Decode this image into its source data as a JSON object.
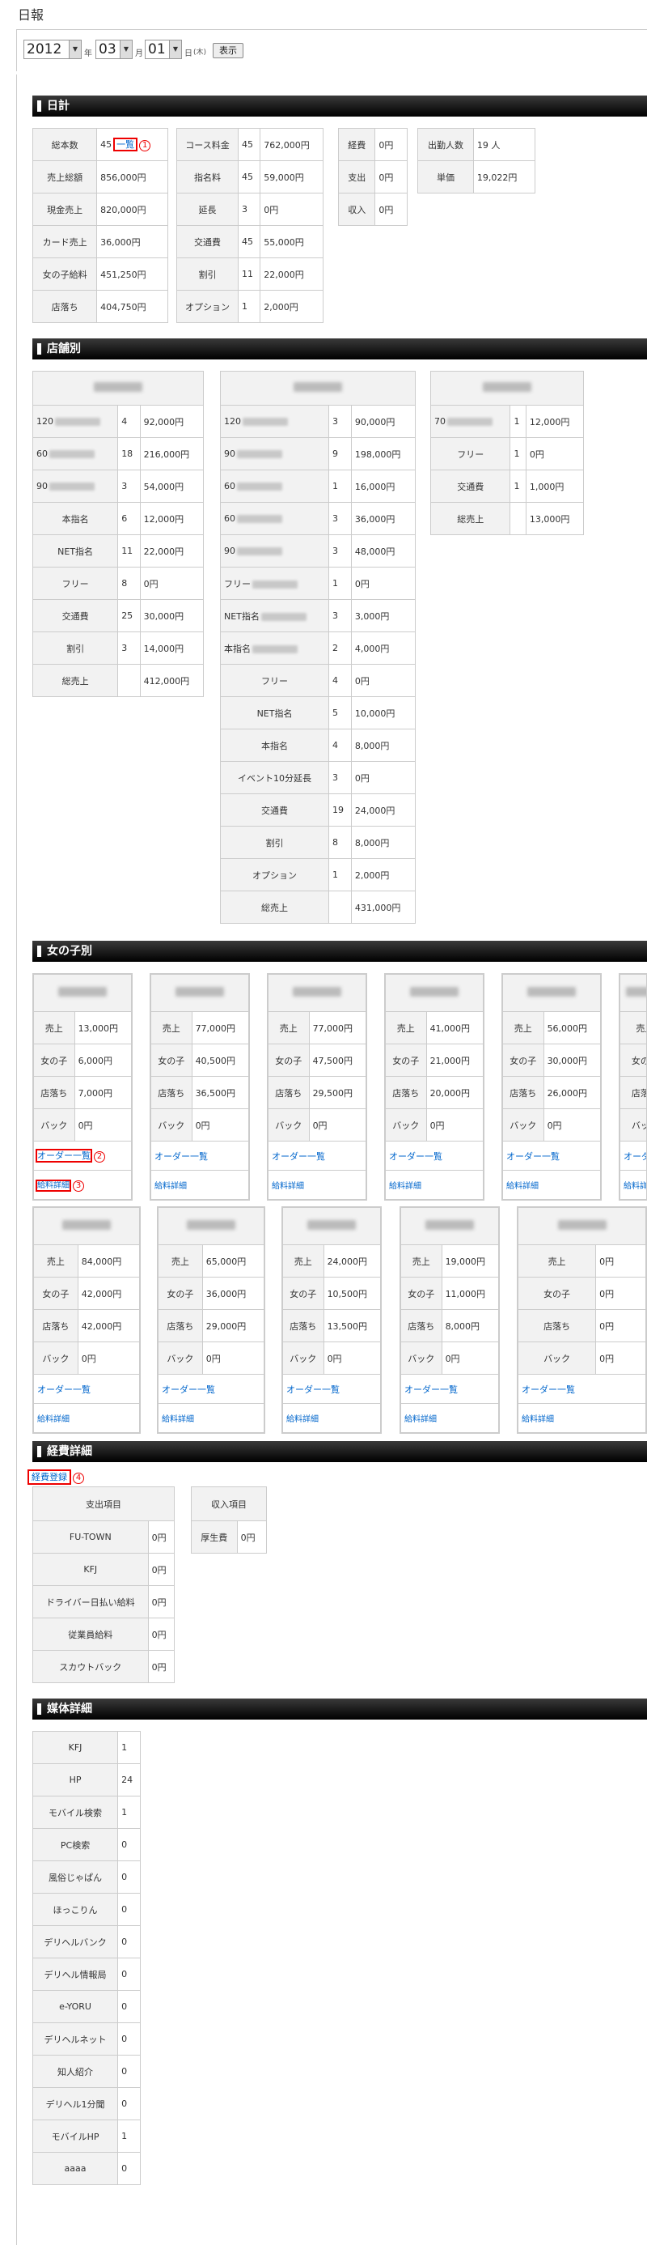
{
  "page_title": "日報",
  "date": {
    "year": "2012",
    "year_unit": "年",
    "month": "03",
    "month_unit": "月",
    "day": "01",
    "day_unit": "日",
    "weekday": "(木)",
    "show_button": "表示"
  },
  "sections": {
    "daily": "日計",
    "stores": "店舗別",
    "girls": "女の子別",
    "expenses": "経費詳細",
    "media": "媒体詳細"
  },
  "daily": {
    "t1": [
      {
        "label": "総本数",
        "value": "45",
        "link": "一覧",
        "marker": "1"
      },
      {
        "label": "売上総額",
        "value": "856,000円"
      },
      {
        "label": "現金売上",
        "value": "820,000円"
      },
      {
        "label": "カード売上",
        "value": "36,000円"
      },
      {
        "label": "女の子給料",
        "value": "451,250円"
      },
      {
        "label": "店落ち",
        "value": "404,750円"
      }
    ],
    "t2": [
      {
        "label": "コース料金",
        "count": "45",
        "value": "762,000円"
      },
      {
        "label": "指名料",
        "count": "45",
        "value": "59,000円"
      },
      {
        "label": "延長",
        "count": "3",
        "value": "0円"
      },
      {
        "label": "交通費",
        "count": "45",
        "value": "55,000円"
      },
      {
        "label": "割引",
        "count": "11",
        "value": "22,000円"
      },
      {
        "label": "オプション",
        "count": "1",
        "value": "2,000円"
      }
    ],
    "t3": [
      {
        "label": "経費",
        "value": "0円"
      },
      {
        "label": "支出",
        "value": "0円"
      },
      {
        "label": "収入",
        "value": "0円"
      }
    ],
    "t4": [
      {
        "label": "出勤人数",
        "value": "19 人"
      },
      {
        "label": "単価",
        "value": "19,022円"
      }
    ]
  },
  "stores": {
    "s1": {
      "rows": [
        {
          "label": "120",
          "count": "4",
          "value": "92,000円",
          "blur": true
        },
        {
          "label": "60",
          "count": "18",
          "value": "216,000円",
          "blur": true
        },
        {
          "label": "90",
          "count": "3",
          "value": "54,000円",
          "blur": true
        },
        {
          "label": "本指名",
          "count": "6",
          "value": "12,000円"
        },
        {
          "label": "NET指名",
          "count": "11",
          "value": "22,000円"
        },
        {
          "label": "フリー",
          "count": "8",
          "value": "0円"
        },
        {
          "label": "交通費",
          "count": "25",
          "value": "30,000円"
        },
        {
          "label": "割引",
          "count": "3",
          "value": "14,000円"
        },
        {
          "label": "総売上",
          "count": "",
          "value": "412,000円"
        }
      ]
    },
    "s2": {
      "rows": [
        {
          "label": "120",
          "count": "3",
          "value": "90,000円",
          "blur": true
        },
        {
          "label": "90",
          "count": "9",
          "value": "198,000円",
          "blur": true
        },
        {
          "label": "60",
          "count": "1",
          "value": "16,000円",
          "blur": true
        },
        {
          "label": "60",
          "count": "3",
          "value": "36,000円",
          "blur": true
        },
        {
          "label": "90",
          "count": "3",
          "value": "48,000円",
          "blur": true
        },
        {
          "label": "フリー",
          "count": "1",
          "value": "0円",
          "blur": true
        },
        {
          "label": "NET指名",
          "count": "3",
          "value": "3,000円",
          "blur": true
        },
        {
          "label": "本指名",
          "count": "2",
          "value": "4,000円",
          "blur": true
        },
        {
          "label": "フリー",
          "count": "4",
          "value": "0円"
        },
        {
          "label": "NET指名",
          "count": "5",
          "value": "10,000円"
        },
        {
          "label": "本指名",
          "count": "4",
          "value": "8,000円"
        },
        {
          "label": "イベント10分延長",
          "count": "3",
          "value": "0円"
        },
        {
          "label": "交通費",
          "count": "19",
          "value": "24,000円"
        },
        {
          "label": "割引",
          "count": "8",
          "value": "8,000円"
        },
        {
          "label": "オプション",
          "count": "1",
          "value": "2,000円"
        },
        {
          "label": "総売上",
          "count": "",
          "value": "431,000円"
        }
      ]
    },
    "s3": {
      "rows": [
        {
          "label": "70",
          "count": "1",
          "value": "12,000円",
          "blur": true
        },
        {
          "label": "フリー",
          "count": "1",
          "value": "0円"
        },
        {
          "label": "交通費",
          "count": "1",
          "value": "1,000円"
        },
        {
          "label": "総売上",
          "count": "",
          "value": "13,000円"
        }
      ]
    }
  },
  "girls_labels": {
    "sales": "売上",
    "girl": "女の子",
    "store": "店落ち",
    "back": "バック",
    "orders": "オーダー一覧",
    "salary": "給料詳細"
  },
  "girls_row1": [
    {
      "sales": "13,000円",
      "girl": "6,000円",
      "store": "7,000円",
      "back": "0円"
    },
    {
      "sales": "77,000円",
      "girl": "40,500円",
      "store": "36,500円",
      "back": "0円"
    },
    {
      "sales": "77,000円",
      "girl": "47,500円",
      "store": "29,500円",
      "back": "0円"
    },
    {
      "sales": "41,000円",
      "girl": "21,000円",
      "store": "20,000円",
      "back": "0円"
    },
    {
      "sales": "56,000円",
      "girl": "30,000円",
      "store": "26,000円",
      "back": "0円"
    },
    {
      "sales": "",
      "girl": "",
      "store": "",
      "back": ""
    }
  ],
  "girls_row2": [
    {
      "sales": "84,000円",
      "girl": "42,000円",
      "store": "42,000円",
      "back": "0円"
    },
    {
      "sales": "65,000円",
      "girl": "36,000円",
      "store": "29,000円",
      "back": "0円"
    },
    {
      "sales": "24,000円",
      "girl": "10,500円",
      "store": "13,500円",
      "back": "0円"
    },
    {
      "sales": "19,000円",
      "girl": "11,000円",
      "store": "8,000円",
      "back": "0円"
    },
    {
      "sales": "0円",
      "girl": "0円",
      "store": "0円",
      "back": "0円"
    }
  ],
  "markers": {
    "m1": "1",
    "m2": "2",
    "m3": "3",
    "m4": "4"
  },
  "expenses": {
    "register_link": "経費登録",
    "out_header": "支出項目",
    "out_rows": [
      {
        "label": "FU-TOWN",
        "value": "0円"
      },
      {
        "label": "KFJ",
        "value": "0円"
      },
      {
        "label": "ドライバー日払い給料",
        "value": "0円"
      },
      {
        "label": "従業員給料",
        "value": "0円"
      },
      {
        "label": "スカウトバック",
        "value": "0円"
      }
    ],
    "in_header": "収入項目",
    "in_rows": [
      {
        "label": "厚生費",
        "value": "0円"
      }
    ]
  },
  "media": [
    {
      "label": "KFJ",
      "value": "1"
    },
    {
      "label": "HP",
      "value": "24"
    },
    {
      "label": "モバイル検索",
      "value": "1"
    },
    {
      "label": "PC検索",
      "value": "0"
    },
    {
      "label": "風俗じゃぱん",
      "value": "0"
    },
    {
      "label": "ほっこりん",
      "value": "0"
    },
    {
      "label": "デリヘルバンク",
      "value": "0"
    },
    {
      "label": "デリヘル情報局",
      "value": "0"
    },
    {
      "label": "e-YORU",
      "value": "0"
    },
    {
      "label": "デリヘルネット",
      "value": "0"
    },
    {
      "label": "知人紹介",
      "value": "0"
    },
    {
      "label": "デリヘル1分聞",
      "value": "0"
    },
    {
      "label": "モバイルHP",
      "value": "1"
    },
    {
      "label": "aaaa",
      "value": "0"
    }
  ],
  "colors": {
    "link": "#0066cc",
    "marker": "#e00000",
    "header_bg": "#000000",
    "cell_bg": "#f2f2f2"
  }
}
